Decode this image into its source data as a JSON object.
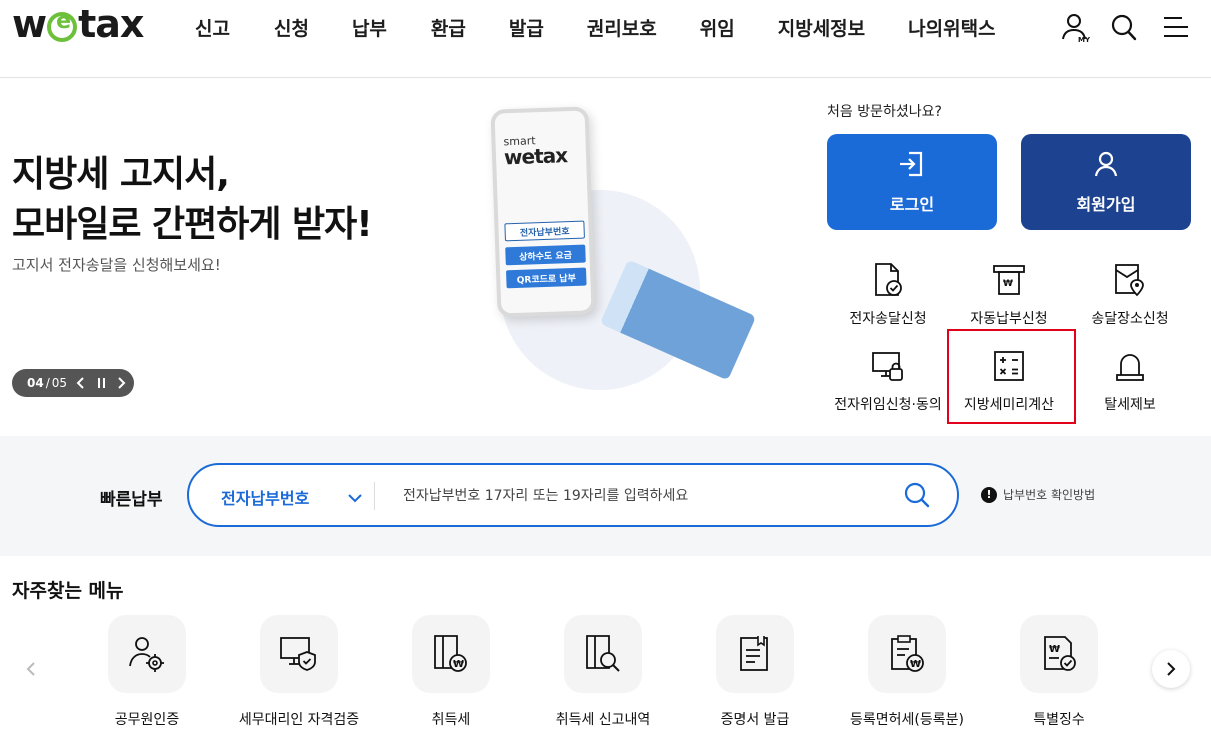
{
  "header": {
    "logo_text": "wetax",
    "nav": [
      "신고",
      "신청",
      "납부",
      "환급",
      "발급",
      "권리보호",
      "위임",
      "지방세정보",
      "나의위택스"
    ],
    "my_label": "MY"
  },
  "hero": {
    "title_line1": "지방세 고지서,",
    "title_line2": "모바일로 간편하게 받자!",
    "subtitle": "고지서 전자송달을 신청해보세요!",
    "pager": {
      "current": "04",
      "separator": "/",
      "total": "05"
    },
    "phone": {
      "brand_small": "smart",
      "brand_logo": "wetax",
      "buttons": [
        "전자납부번호",
        "상하수도 요금",
        "QR코드로 납부"
      ]
    }
  },
  "side": {
    "first_visit": "처음 방문하셨나요?",
    "login_label": "로그인",
    "join_label": "회원가입",
    "services": [
      {
        "label": "전자송달신청",
        "icon": "document-check-icon"
      },
      {
        "label": "자동납부신청",
        "icon": "atm-icon"
      },
      {
        "label": "송달장소신청",
        "icon": "location-pin-icon"
      },
      {
        "label": "전자위임신청·동의",
        "icon": "monitor-lock-icon"
      },
      {
        "label": "지방세미리계산",
        "icon": "calculator-icon"
      },
      {
        "label": "탈세제보",
        "icon": "siren-icon"
      }
    ]
  },
  "quick": {
    "label": "빠른납부",
    "select_value": "전자납부번호",
    "placeholder": "전자납부번호 17자리 또는 19자리를 입력하세요",
    "help_text": "납부번호 확인방법"
  },
  "frequent": {
    "title": "자주찾는 메뉴",
    "items": [
      {
        "label": "공무원인증",
        "icon": "official-gear-icon"
      },
      {
        "label": "세무대리인 자격검증",
        "icon": "monitor-shield-icon"
      },
      {
        "label": "취득세",
        "icon": "box-won-icon"
      },
      {
        "label": "취득세 신고내역",
        "icon": "box-search-icon"
      },
      {
        "label": "증명서 발급",
        "icon": "certificate-icon"
      },
      {
        "label": "등록면허세(등록분)",
        "icon": "clipboard-won-icon"
      },
      {
        "label": "특별징수",
        "icon": "document-won-check-icon"
      }
    ]
  },
  "colors": {
    "primary": "#1a6ad8",
    "navy": "#1d428f",
    "logo_green": "#6cc03a",
    "highlight_red": "#e2001a"
  }
}
